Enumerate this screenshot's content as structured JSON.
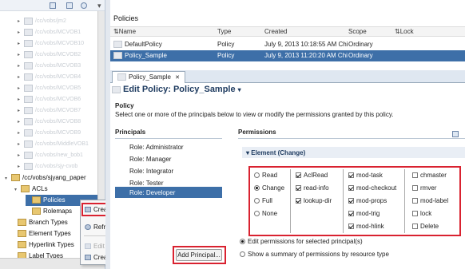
{
  "tree": {
    "dim_items": [
      "/cc/vobs/jm2",
      "/cc/vobs/MCVOB1",
      "/cc/vobs/MCVOB10",
      "/cc/vobs/MCVOB2",
      "/cc/vobs/MCVOB3",
      "/cc/vobs/MCVOB4",
      "/cc/vobs/MCVOB5",
      "/cc/vobs/MCVOB6",
      "/cc/vobs/MCVOB7",
      "/cc/vobs/MCVOB8",
      "/cc/vobs/MCVOB9",
      "/cc/vobs/MiddleVOB1",
      "/cc/vobs/new_bob1",
      "/cc/vobs/sjy-cvob"
    ],
    "project": "/cc/vobs/sjyang_paper",
    "acls": "ACLs",
    "policies": "Policies",
    "rolemaps": "Rolemaps",
    "branch_types": "Branch Types",
    "element_types": "Element Types",
    "hyperlink_types": "Hyperlink Types",
    "label_types": "Label Types"
  },
  "context_menu": {
    "create_policy": "Create a Policy...",
    "refresh": "Refresh",
    "edit_working_set": "Edit Working Set",
    "create_working_set": "Create Working Set..."
  },
  "policies_view": {
    "title": "Policies",
    "columns": [
      "Name",
      "Type",
      "Created",
      "Scope",
      "Lock"
    ],
    "rows": [
      {
        "name": "DefaultPolicy",
        "type": "Policy",
        "created": "July 9, 2013 10:18:55 AM Chi",
        "scope": "Ordinary",
        "lock": ""
      },
      {
        "name": "Policy_Sample",
        "type": "Policy",
        "created": "July 9, 2013 11:20:20 AM Chi",
        "scope": "Ordinary",
        "lock": ""
      }
    ]
  },
  "editor": {
    "tab_label": "Policy_Sample",
    "title": "Edit Policy: Policy_Sample",
    "section": "Policy",
    "description": "Select one or more of the principals below to view or modify the permissions granted by this policy.",
    "principals_heading": "Principals",
    "principals": [
      "Role: Administrator",
      "Role: Manager",
      "Role: Integrator",
      "Role: Tester",
      "Role: Developer"
    ],
    "permissions_heading": "Permissions",
    "element_heading": "Element",
    "change_link": "(Change)",
    "levels": [
      "Read",
      "Change",
      "Full",
      "None"
    ],
    "perms_col1": [
      "AclRead",
      "read-info",
      "lookup-dir"
    ],
    "perms_col2": [
      "mod-task",
      "mod-checkout",
      "mod-props",
      "mod-trig",
      "mod-hlink"
    ],
    "perms_col3": [
      "chmaster",
      "rmver",
      "mod-label",
      "lock",
      "Delete"
    ],
    "add_principal": "Add Principal...",
    "option_edit": "Edit permissions for selected principal(s)",
    "option_summary": "Show a summary of permissions by resource type"
  },
  "colors": {
    "selection": "#3d6fa8",
    "highlight_box": "#d92230"
  }
}
